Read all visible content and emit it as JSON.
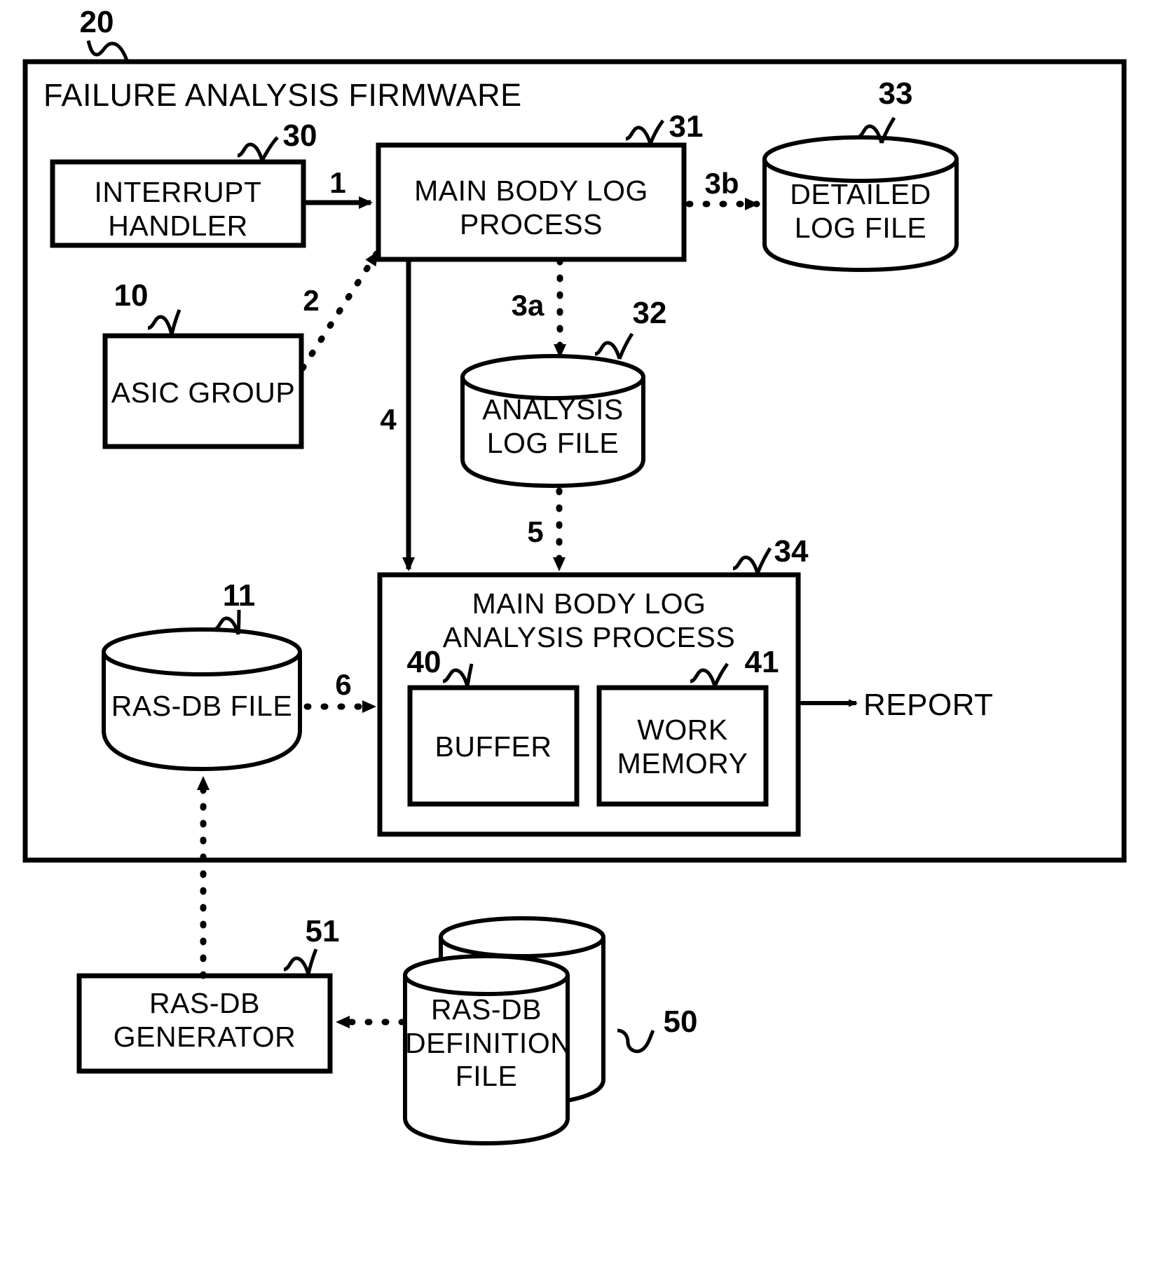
{
  "figure": {
    "title": "FAILURE ANALYSIS FIRMWARE",
    "outer_ref": "20"
  },
  "nodes": {
    "interrupt_handler": {
      "label": "INTERRUPT\nHANDLER",
      "ref": "30",
      "shape": "rectangle"
    },
    "main_body_log_process": {
      "label": "MAIN BODY LOG\nPROCESS",
      "ref": "31",
      "shape": "rectangle"
    },
    "detailed_log_file": {
      "label": "DETAILED\nLOG FILE",
      "ref": "33",
      "shape": "cylinder"
    },
    "asic_group": {
      "label": "ASIC GROUP",
      "ref": "10",
      "shape": "rectangle"
    },
    "analysis_log_file": {
      "label": "ANALYSIS\nLOG FILE",
      "ref": "32",
      "shape": "cylinder"
    },
    "ras_db_file": {
      "label": "RAS-DB FILE",
      "ref": "11",
      "shape": "cylinder"
    },
    "main_body_log_analysis_process": {
      "label": "MAIN BODY LOG\nANALYSIS PROCESS",
      "ref": "34",
      "shape": "rectangle"
    },
    "buffer": {
      "label": "BUFFER",
      "ref": "40",
      "shape": "rectangle"
    },
    "work_memory": {
      "label": "WORK\nMEMORY",
      "ref": "41",
      "shape": "rectangle"
    },
    "ras_db_generator": {
      "label": "RAS-DB\nGENERATOR",
      "ref": "51",
      "shape": "rectangle"
    },
    "ras_db_definition_file": {
      "label": "RAS-DB\nDEFINITION\nFILE",
      "ref": "50",
      "shape": "stacked-cylinder"
    },
    "report": {
      "label": "REPORT",
      "ref": "",
      "shape": "text"
    }
  },
  "flows": [
    {
      "id": "1",
      "label": "1",
      "from": "interrupt_handler",
      "to": "main_body_log_process",
      "style": "solid"
    },
    {
      "id": "2",
      "label": "2",
      "from": "asic_group",
      "to": "main_body_log_process",
      "style": "dotted"
    },
    {
      "id": "3a",
      "label": "3a",
      "from": "main_body_log_process",
      "to": "analysis_log_file",
      "style": "dotted"
    },
    {
      "id": "3b",
      "label": "3b",
      "from": "main_body_log_process",
      "to": "detailed_log_file",
      "style": "dotted"
    },
    {
      "id": "4",
      "label": "4",
      "from": "main_body_log_process",
      "to": "main_body_log_analysis_process",
      "style": "solid"
    },
    {
      "id": "5",
      "label": "5",
      "from": "analysis_log_file",
      "to": "main_body_log_analysis_process",
      "style": "dotted"
    },
    {
      "id": "6",
      "label": "6",
      "from": "ras_db_file",
      "to": "main_body_log_analysis_process",
      "style": "dotted"
    },
    {
      "id": "gen-to-db",
      "label": "",
      "from": "ras_db_generator",
      "to": "ras_db_file",
      "style": "dotted"
    },
    {
      "id": "def-to-gen",
      "label": "",
      "from": "ras_db_definition_file",
      "to": "ras_db_generator",
      "style": "dotted"
    },
    {
      "id": "report-out",
      "label": "",
      "from": "main_body_log_analysis_process",
      "to": "report",
      "style": "solid"
    }
  ],
  "colors": {
    "stroke": "#000000",
    "background": "#ffffff",
    "text": "#000000"
  }
}
